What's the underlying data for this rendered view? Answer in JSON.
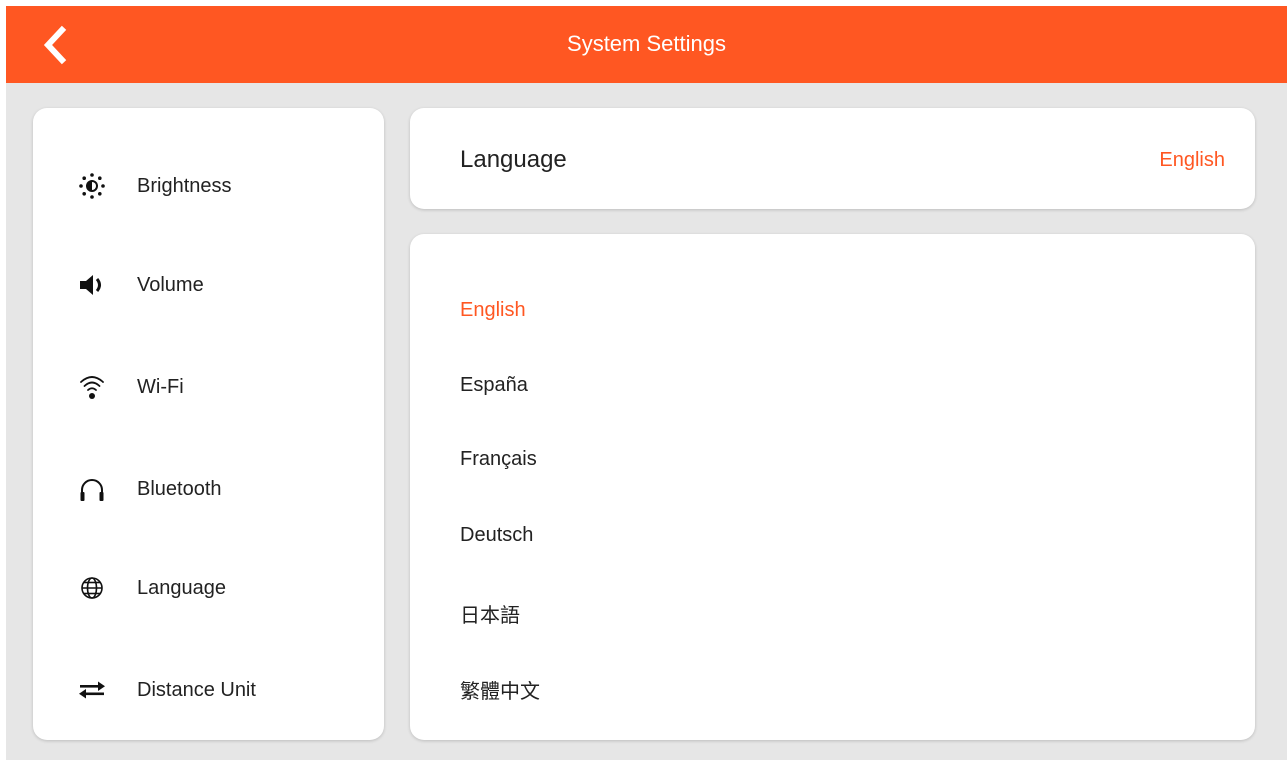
{
  "header": {
    "title": "System Settings",
    "back_icon": "chevron-left-icon",
    "background_color": "#ff5722"
  },
  "sidebar": {
    "items": [
      {
        "label": "Brightness",
        "icon": "brightness-icon"
      },
      {
        "label": "Volume",
        "icon": "volume-icon"
      },
      {
        "label": "Wi-Fi",
        "icon": "wifi-icon"
      },
      {
        "label": "Bluetooth",
        "icon": "headphones-icon"
      },
      {
        "label": "Language",
        "icon": "globe-icon"
      },
      {
        "label": "Distance Unit",
        "icon": "swap-arrows-icon"
      }
    ]
  },
  "language_panel": {
    "title": "Language",
    "current_value": "English",
    "options": [
      "English",
      "España",
      "Français",
      "Deutsch",
      "日本語",
      "繁體中文"
    ],
    "selected": "English",
    "accent_color": "#ff5722"
  }
}
